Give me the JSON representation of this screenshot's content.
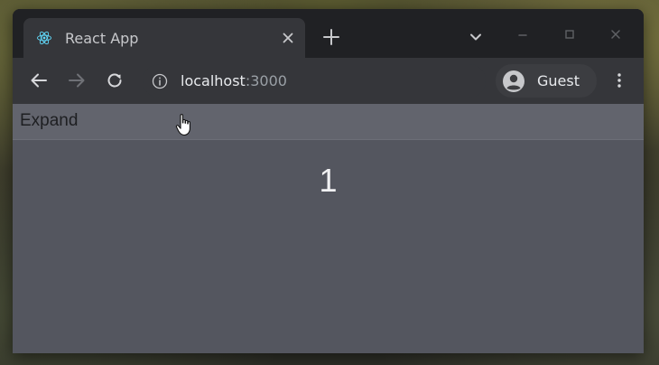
{
  "browser": {
    "tab": {
      "title": "React App",
      "favicon": "react-logo-icon"
    },
    "address_bar": {
      "host": "localhost",
      "port": ":3000"
    },
    "profile": {
      "name": "Guest",
      "icon": "account-circle-icon"
    },
    "icons": {
      "back": "arrow-left-icon",
      "forward": "arrow-right-icon",
      "reload": "reload-icon",
      "info": "info-icon",
      "menu": "kebab-menu-icon",
      "new_tab": "plus-icon",
      "tab_search": "chevron-down-icon",
      "minimize": "minimize-icon",
      "maximize": "maximize-icon",
      "close": "close-icon"
    },
    "colors": {
      "frame": "#202124",
      "toolbar": "#35363a",
      "page_background": "#54565f",
      "expand_bar": "#62646d",
      "react_accent": "#61dafb"
    }
  },
  "page": {
    "expand_button_label": "Expand",
    "counter_value": "1"
  }
}
